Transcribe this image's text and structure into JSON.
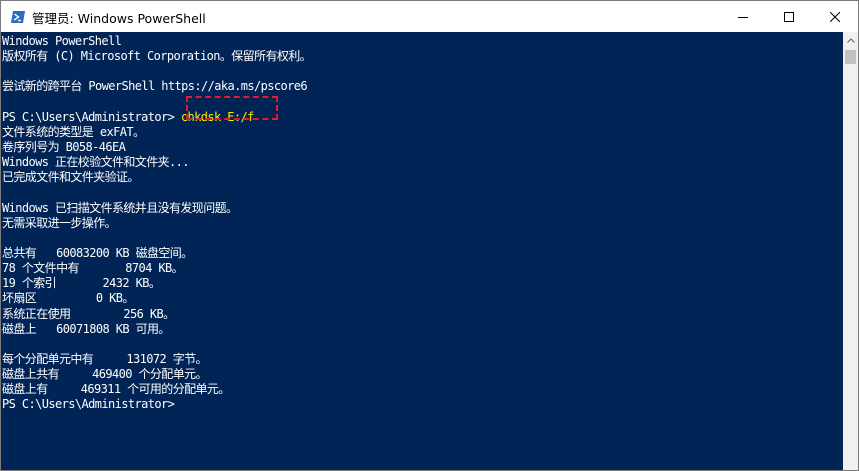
{
  "window": {
    "title": "管理员: Windows PowerShell",
    "icon": "powershell-icon",
    "controls": [
      "minimize-icon",
      "maximize-icon",
      "close-icon"
    ],
    "background": "#012456",
    "titlebar_color": "#ffffff"
  },
  "console": {
    "lines": [
      "Windows PowerShell",
      "版权所有 (C) Microsoft Corporation。保留所有权利。",
      "",
      "尝试新的跨平台 PowerShell https://aka.ms/pscore6",
      "",
      "PS C:\\Users\\Administrator> ",
      "文件系统的类型是 exFAT。",
      "卷序列号为 B058-46EA",
      "Windows 正在校验文件和文件夹...",
      "已完成文件和文件夹验证。",
      "",
      "Windows 已扫描文件系统并且没有发现问题。",
      "无需采取进一步操作。",
      "",
      "总共有   60083200 KB 磁盘空间。",
      "78 个文件中有       8704 KB。",
      "19 个索引       2432 KB。",
      "坏扇区         0 KB。",
      "系统正在使用        256 KB。",
      "磁盘上   60071808 KB 可用。",
      "",
      "每个分配单元中有     131072 字节。",
      "磁盘上共有     469400 个分配单元。",
      "磁盘上有     469311 个可用的分配单元。",
      "PS C:\\Users\\Administrator>"
    ],
    "command": "chkdsk E:/f",
    "text_color": "#ffffff",
    "command_color": "#f0f000",
    "highlight_color": "#e8192c"
  }
}
